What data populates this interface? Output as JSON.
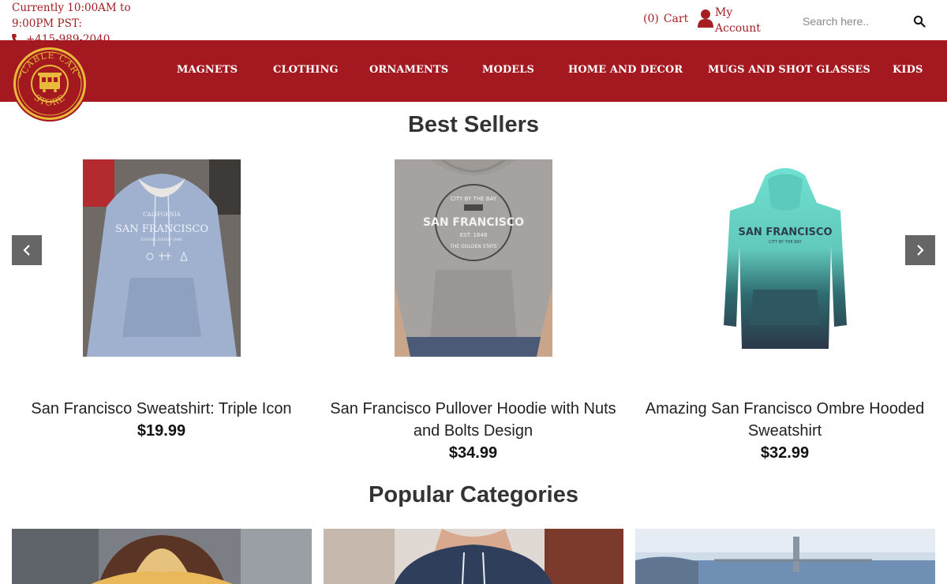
{
  "header": {
    "hours_line1": "Currently 10:00AM to",
    "hours_line2": "9:00PM PST:",
    "phone": "+415-989-2040",
    "cart_count": "(0)",
    "cart_label": "Cart",
    "account_line1": "My",
    "account_line2": "Account",
    "search_placeholder": "Search here.."
  },
  "logo": {
    "top_text": "CABLE CAR",
    "bottom_text": "STORE"
  },
  "nav": {
    "items": [
      "MAGNETS",
      "CLOTHING",
      "ORNAMENTS",
      "MODELS",
      "HOME AND DECOR",
      "MUGS AND SHOT GLASSES",
      "KIDS"
    ]
  },
  "best_sellers": {
    "title": "Best Sellers",
    "products": [
      {
        "name": "San Francisco Sweatshirt: Triple Icon",
        "price": "$19.99",
        "print_small_top": "CALIFORNIA",
        "print_main": "SAN FRANCISCO",
        "print_small_bottom": "ESTABLISHED 1848"
      },
      {
        "name": "San Francisco Pullover Hoodie with Nuts and Bolts Design",
        "price": "$34.99",
        "print_arc_top": "CITY BY THE BAY",
        "print_main": "SAN FRANCISCO",
        "print_est": "EST. 1848",
        "print_arc_bottom": "THE GOLDEN STATE"
      },
      {
        "name": "Amazing San Francisco Ombre Hooded Sweatshirt",
        "price": "$32.99",
        "print_main": "SAN FRANCISCO",
        "print_sub": "CITY BY THE BAY"
      }
    ]
  },
  "popular_categories": {
    "title": "Popular Categories"
  },
  "colors": {
    "brand_red": "#a3191f",
    "logo_gold": "#e8b93a"
  }
}
